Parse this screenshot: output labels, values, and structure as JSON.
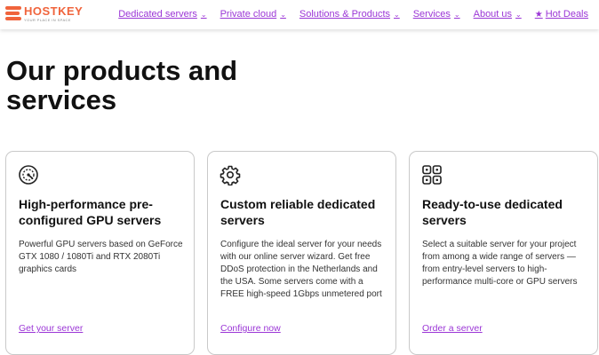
{
  "brand": {
    "name": "HOSTKEY",
    "tagline": "Your place in space",
    "accent_color": "#f0643c",
    "link_color": "#9b36d6"
  },
  "nav": {
    "items": [
      {
        "label": "Dedicated servers",
        "icon": "chevron-down-icon"
      },
      {
        "label": "Private cloud",
        "icon": "chevron-down-icon"
      },
      {
        "label": "Solutions & Products",
        "icon": "chevron-down-icon"
      },
      {
        "label": "Services",
        "icon": "chevron-down-icon"
      },
      {
        "label": "About us",
        "icon": "chevron-down-icon"
      },
      {
        "label": "Hot Deals",
        "icon": "star-icon"
      }
    ]
  },
  "main": {
    "title": "Our products and services",
    "cards": [
      {
        "icon": "gauge-icon",
        "title": "High-performance pre-configured GPU servers",
        "description": "Powerful GPU servers based on GeForce GTX 1080 / 1080Ti and RTX 2080Ti graphics cards",
        "link": "Get your server"
      },
      {
        "icon": "gear-icon",
        "title": "Custom reliable dedicated servers",
        "description": "Configure the ideal server for your needs with our online server wizard. Get free DDoS protection in the Netherlands and the USA. Some servers come with a FREE high-speed 1Gbps unmetered port",
        "link": "Configure now"
      },
      {
        "icon": "grid-icon",
        "title": "Ready-to-use dedicated servers",
        "description": "Select a suitable server for your project from among a wide range of servers — from entry-level servers to high-performance multi-core or GPU servers",
        "link": "Order a server"
      }
    ]
  }
}
